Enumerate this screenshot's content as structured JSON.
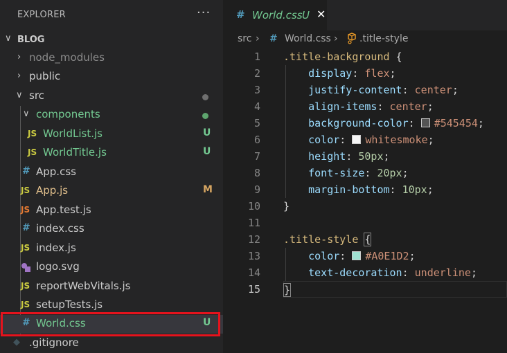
{
  "explorer": {
    "title": "EXPLORER",
    "more": "···",
    "root": "BLOG",
    "items": [
      {
        "label": "node_modules",
        "kind": "folder-closed",
        "color": "#8b8b8b"
      },
      {
        "label": "public",
        "kind": "folder-closed",
        "color": "#cccccc"
      },
      {
        "label": "src",
        "kind": "folder-open",
        "color": "#cccccc",
        "status": "dot",
        "status_color": "#6f6f6f"
      },
      {
        "label": "components",
        "kind": "folder-open",
        "color": "#73c991",
        "status": "dot",
        "status_color": "#5ea56e"
      },
      {
        "label": "WorldList.js",
        "kind": "js",
        "color": "#73c991",
        "icon": "JS",
        "badge": "U",
        "badge_color": "#73c991"
      },
      {
        "label": "WorldTitle.js",
        "kind": "js",
        "color": "#73c991",
        "icon": "JS",
        "badge": "U",
        "badge_color": "#73c991"
      },
      {
        "label": "App.css",
        "kind": "css",
        "color": "#cccccc",
        "icon": "#"
      },
      {
        "label": "App.js",
        "kind": "js",
        "color": "#e2c08d",
        "icon": "JS",
        "badge": "M",
        "badge_color": "#d7a662"
      },
      {
        "label": "App.test.js",
        "kind": "test",
        "color": "#cccccc",
        "icon": "JS"
      },
      {
        "label": "index.css",
        "kind": "css",
        "color": "#cccccc",
        "icon": "#"
      },
      {
        "label": "index.js",
        "kind": "js",
        "color": "#cccccc",
        "icon": "JS"
      },
      {
        "label": "logo.svg",
        "kind": "svg",
        "color": "#cccccc"
      },
      {
        "label": "reportWebVitals.js",
        "kind": "js",
        "color": "#cccccc",
        "icon": "JS"
      },
      {
        "label": "setupTests.js",
        "kind": "js",
        "color": "#cccccc",
        "icon": "JS"
      },
      {
        "label": "World.css",
        "kind": "css",
        "color": "#73c991",
        "icon": "#",
        "badge": "U",
        "badge_color": "#73c991",
        "selected": true
      },
      {
        "label": ".gitignore",
        "kind": "git",
        "color": "#cccccc"
      }
    ]
  },
  "tab": {
    "icon": "#",
    "label": "World.css",
    "badge": "U",
    "close": "✕"
  },
  "breadcrumb": {
    "folder": "src",
    "file": "World.css",
    "symbol": ".title-style"
  },
  "code": {
    "line_numbers": [
      "1",
      "2",
      "3",
      "4",
      "5",
      "6",
      "7",
      "8",
      "9",
      "10",
      "11",
      "12",
      "13",
      "14",
      "15"
    ],
    "active_line": "15",
    "l1_sel": ".title-background",
    "l1_brace": " {",
    "l2_prop": "display",
    "l2_val": "flex",
    "l3_prop": "justify-content",
    "l3_val": "center",
    "l4_prop": "align-items",
    "l4_val": "center",
    "l5_prop": "background-color",
    "l5_val": "#545454",
    "l5_swatch": "#545454",
    "l6_prop": "color",
    "l6_val": "whitesmoke",
    "l6_swatch": "#f5f5f5",
    "l7_prop": "height",
    "l7_val": "50px",
    "l8_prop": "font-size",
    "l8_val": "20px",
    "l9_prop": "margin-bottom",
    "l9_val": "10px",
    "l10": "}",
    "l12_sel": ".title-style",
    "l12_brace": "{",
    "l13_prop": "color",
    "l13_val": "#A0E1D2",
    "l13_swatch": "#a0e1d2",
    "l14_prop": "text-decoration",
    "l14_val": "underline",
    "l15": "}",
    "colon": ": ",
    "semi": ";"
  }
}
